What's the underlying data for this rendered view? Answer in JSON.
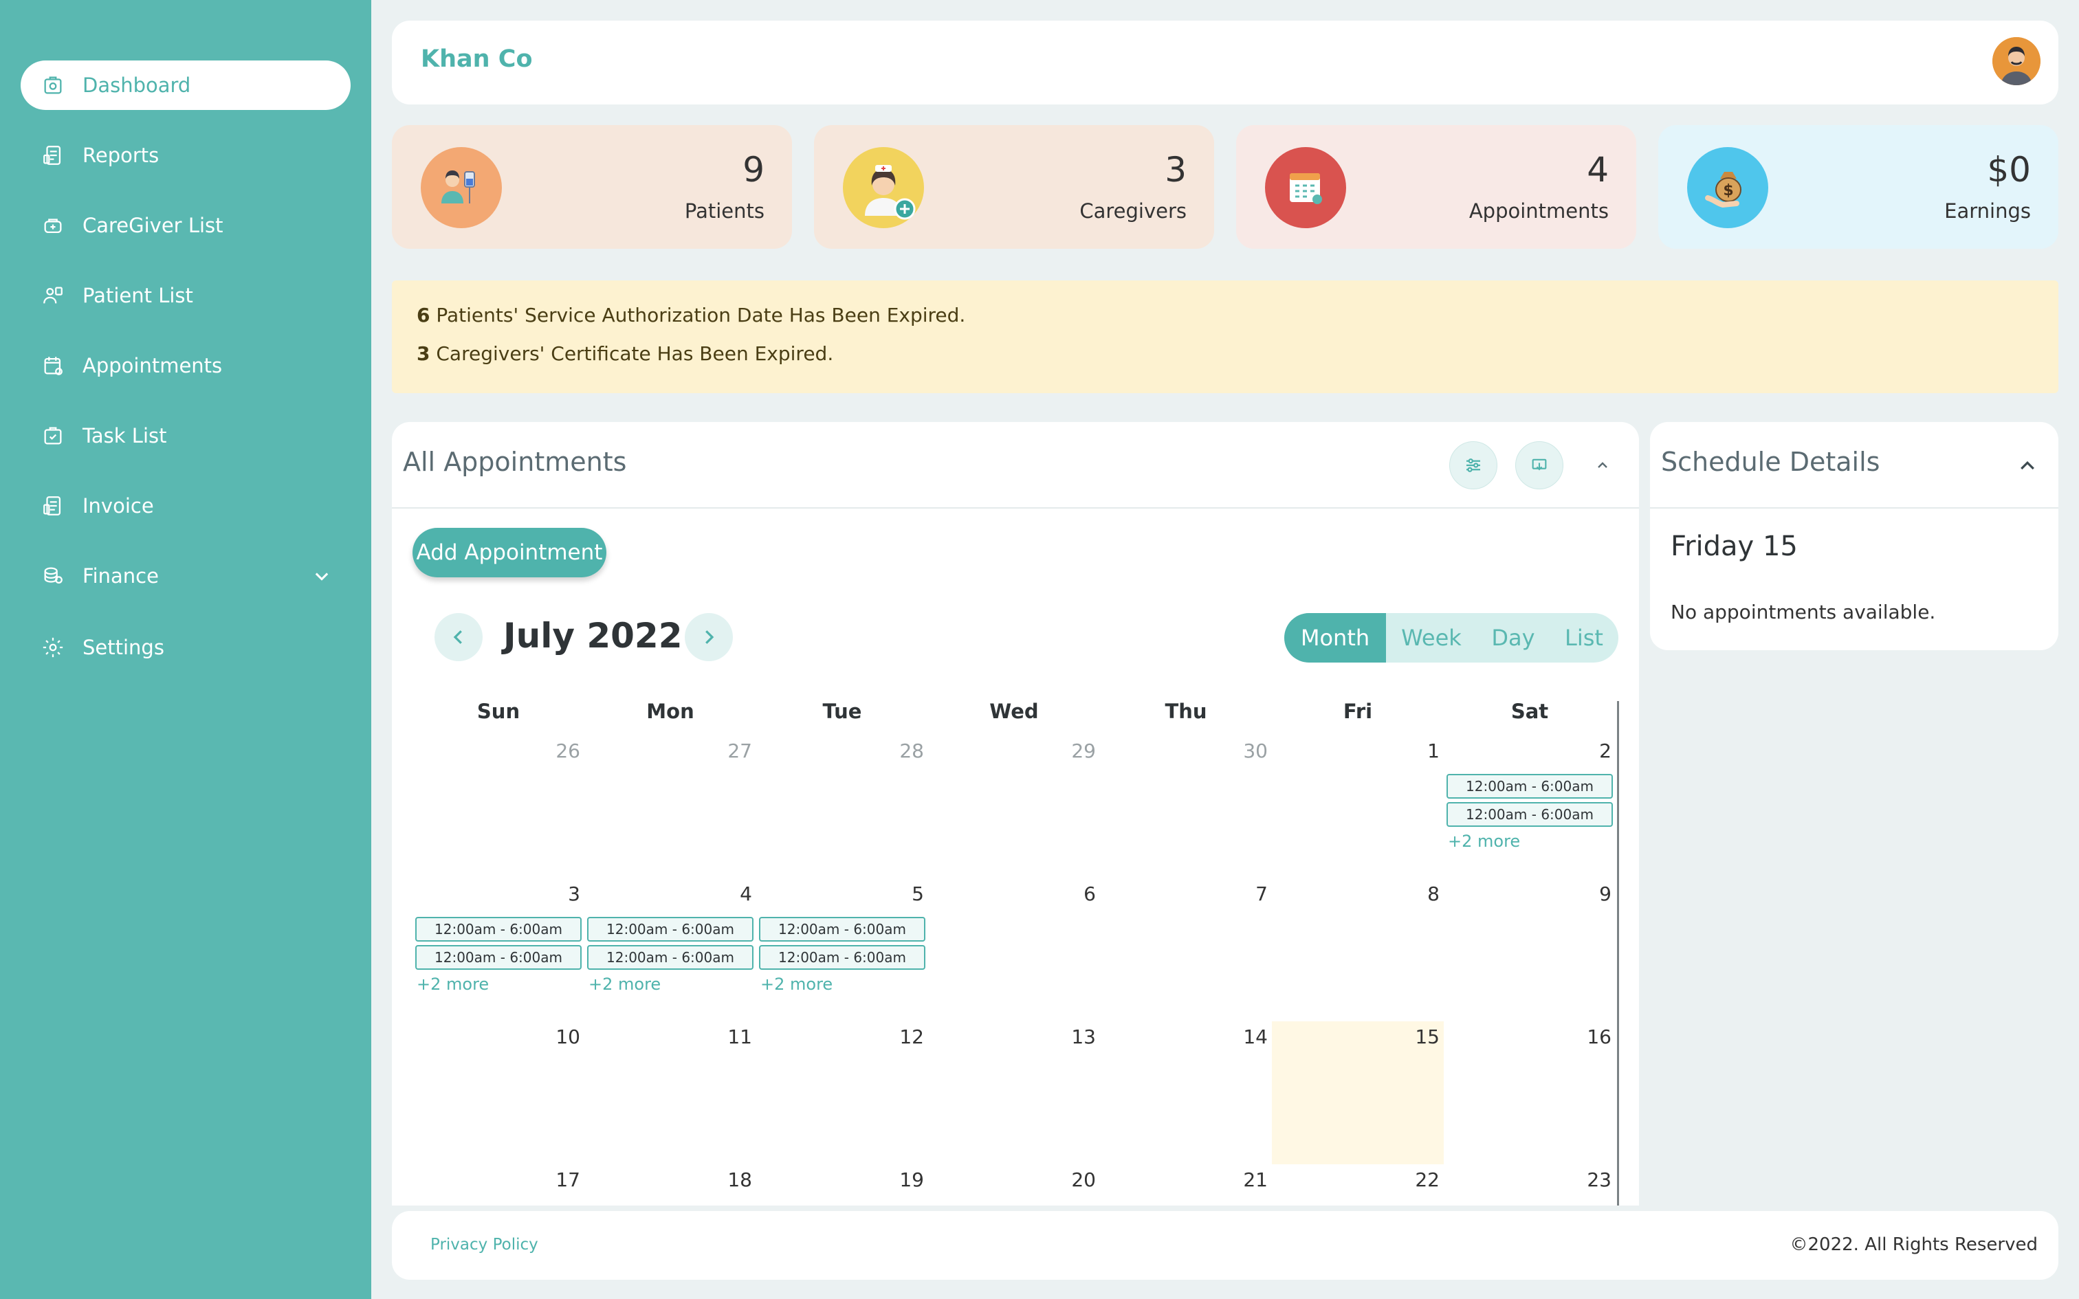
{
  "sidebar": {
    "items": [
      {
        "label": "Dashboard",
        "icon": "dashboard-icon"
      },
      {
        "label": "Reports",
        "icon": "reports-icon"
      },
      {
        "label": "CareGiver List",
        "icon": "caregiver-icon"
      },
      {
        "label": "Patient List",
        "icon": "patient-icon"
      },
      {
        "label": "Appointments",
        "icon": "appointments-icon"
      },
      {
        "label": "Task List",
        "icon": "task-icon"
      },
      {
        "label": "Invoice",
        "icon": "invoice-icon"
      },
      {
        "label": "Finance",
        "icon": "finance-icon"
      },
      {
        "label": "Settings",
        "icon": "settings-icon"
      }
    ],
    "active_index": 0
  },
  "header": {
    "brand": "Khan Co"
  },
  "stats": [
    {
      "value": "9",
      "label": "Patients",
      "color": "#f6e7dc"
    },
    {
      "value": "3",
      "label": "Caregivers",
      "color": "#f6e7dc"
    },
    {
      "value": "4",
      "label": "Appointments",
      "color": "#f8e9e6"
    },
    {
      "value": "$0",
      "label": "Earnings",
      "color": "#e3f5fb"
    }
  ],
  "alert": {
    "line1": {
      "count": "6",
      "text": " Patients' Service Authorization Date Has Been Expired."
    },
    "line2": {
      "count": "3",
      "text": " Caregivers' Certificate Has Been Expired."
    }
  },
  "appointments": {
    "title": "All Appointments",
    "add_label": "Add Appointment",
    "month_label": "July 2022",
    "views": [
      "Month",
      "Week",
      "Day",
      "List"
    ],
    "active_view": "Month",
    "weekdays": [
      "Sun",
      "Mon",
      "Tue",
      "Wed",
      "Thu",
      "Fri",
      "Sat"
    ],
    "weeks": [
      [
        {
          "d": "26",
          "muted": true
        },
        {
          "d": "27",
          "muted": true
        },
        {
          "d": "28",
          "muted": true
        },
        {
          "d": "29",
          "muted": true
        },
        {
          "d": "30",
          "muted": true
        },
        {
          "d": "1"
        },
        {
          "d": "2",
          "events": [
            "12:00am - 6:00am",
            "12:00am - 6:00am"
          ],
          "more": "+2 more"
        }
      ],
      [
        {
          "d": "3",
          "events": [
            "12:00am - 6:00am",
            "12:00am - 6:00am"
          ],
          "more": "+2 more"
        },
        {
          "d": "4",
          "events": [
            "12:00am - 6:00am",
            "12:00am - 6:00am"
          ],
          "more": "+2 more"
        },
        {
          "d": "5",
          "events": [
            "12:00am - 6:00am",
            "12:00am - 6:00am"
          ],
          "more": "+2 more"
        },
        {
          "d": "6"
        },
        {
          "d": "7"
        },
        {
          "d": "8"
        },
        {
          "d": "9"
        }
      ],
      [
        {
          "d": "10"
        },
        {
          "d": "11"
        },
        {
          "d": "12"
        },
        {
          "d": "13"
        },
        {
          "d": "14"
        },
        {
          "d": "15",
          "today": true
        },
        {
          "d": "16"
        }
      ],
      [
        {
          "d": "17"
        },
        {
          "d": "18"
        },
        {
          "d": "19"
        },
        {
          "d": "20"
        },
        {
          "d": "21"
        },
        {
          "d": "22"
        },
        {
          "d": "23"
        }
      ]
    ]
  },
  "schedule": {
    "title": "Schedule Details",
    "day": "Friday 15",
    "empty": "No appointments available."
  },
  "footer": {
    "privacy": "Privacy Policy",
    "copyright": "©2022. All Rights Reserved"
  },
  "colors": {
    "accent": "#4fb3ac",
    "sidebar": "#5ab8b1",
    "alert_bg": "#fdf2d0",
    "today_bg": "#fff8e4"
  }
}
